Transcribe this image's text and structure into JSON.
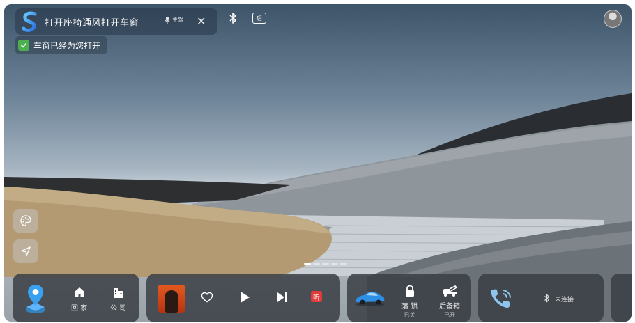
{
  "status_bar": {
    "voice_query": "打开座椅通风打开车窗",
    "mic_label": "主驾",
    "notice": "车窗已经为您打开"
  },
  "icons": {
    "assistant": "assistant-logo-icon",
    "mic": "microphone-icon",
    "close": "close-icon",
    "bluetooth": "bluetooth-icon",
    "rear_display": "rear-display-icon",
    "rear_display_glyph": "后",
    "avatar": "user-avatar-icon"
  },
  "side_buttons": [
    "palette-icon",
    "navigation-arrow-icon"
  ],
  "pager": {
    "pages": 5,
    "active": 0
  },
  "dock": {
    "navigation": {
      "home_label": "回 家",
      "company_label": "公 司"
    },
    "media": {
      "listen_badge": "听"
    },
    "vehicle": {
      "lock_label": "落 锁",
      "lock_status": "已关",
      "trunk_label": "后备箱",
      "trunk_status": "已开"
    },
    "phone": {
      "status": "未连接"
    }
  },
  "colors": {
    "dock_bg": "#3a3e44",
    "check_green": "#4cb050",
    "map_pin_blue": "#3aa0f0",
    "listen_red": "#e23b3b"
  }
}
